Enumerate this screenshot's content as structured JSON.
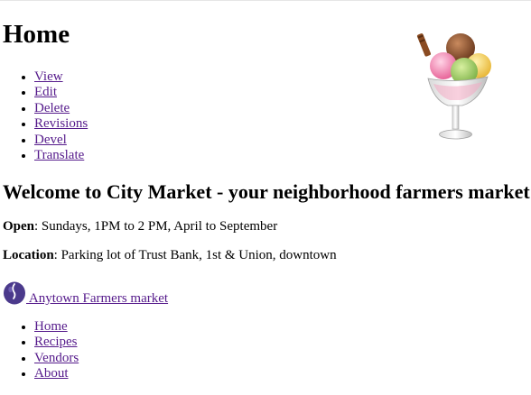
{
  "page": {
    "title": "Home"
  },
  "tabs": [
    {
      "label": "View"
    },
    {
      "label": "Edit"
    },
    {
      "label": "Delete"
    },
    {
      "label": "Revisions"
    },
    {
      "label": "Devel"
    },
    {
      "label": "Translate"
    }
  ],
  "content": {
    "heading": "Welcome to City Market - your neighborhood farmers market!",
    "open": {
      "label": "Open",
      "value": ": Sundays, 1PM to 2 PM, April to September"
    },
    "location": {
      "label": "Location",
      "value": ": Parking lot of Trust Bank, 1st & Union, downtown"
    }
  },
  "brand": {
    "name": " Anytown Farmers market",
    "logo_icon": "plum-logo-icon",
    "logo_color": "#4b3a8c"
  },
  "site_nav": [
    {
      "label": "Home"
    },
    {
      "label": "Recipes"
    },
    {
      "label": "Vendors"
    },
    {
      "label": "About"
    }
  ],
  "images": {
    "header_image": "ice-cream-sundae-image"
  },
  "colors": {
    "link": "#551a8b",
    "text": "#000000",
    "background": "#ffffff"
  }
}
